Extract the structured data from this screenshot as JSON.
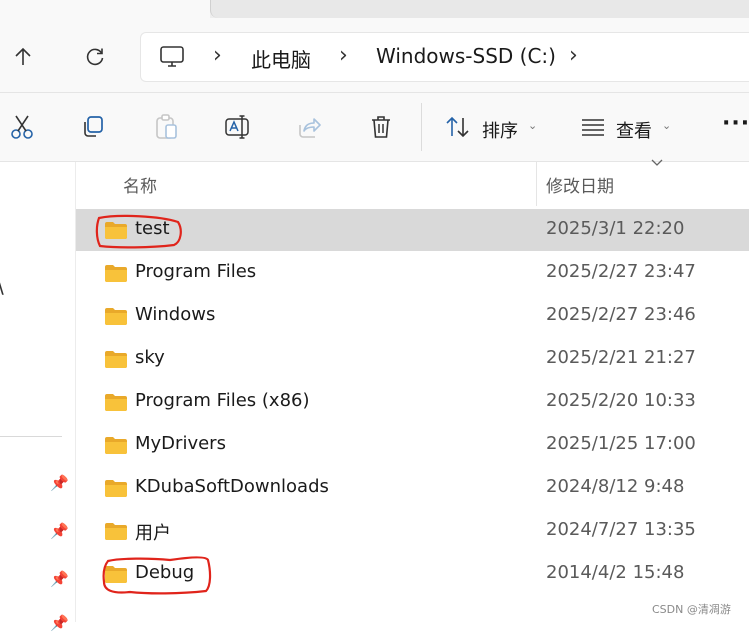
{
  "navigation": {
    "breadcrumb": [
      "此电脑",
      "Windows-SSD (C:)"
    ],
    "icons": [
      "up-arrow-icon",
      "refresh-icon",
      "computer-icon",
      "chevron-right-icon"
    ]
  },
  "commands": {
    "icons": [
      "cut-icon",
      "copy-icon",
      "paste-icon",
      "rename-icon",
      "share-icon",
      "delete-icon",
      "sort-icon",
      "view-icon",
      "more-icon"
    ],
    "sort_label": "排序",
    "view_label": "查看",
    "more_label": "···"
  },
  "columns": {
    "name": "名称",
    "date": "修改日期"
  },
  "files": [
    {
      "name": "test",
      "date": "2025/3/1 22:20",
      "selected": true,
      "circled": true
    },
    {
      "name": "Program Files",
      "date": "2025/2/27 23:47"
    },
    {
      "name": "Windows",
      "date": "2025/2/27 23:46"
    },
    {
      "name": "sky",
      "date": "2025/2/21 21:27"
    },
    {
      "name": "Program Files (x86)",
      "date": "2025/2/20 10:33"
    },
    {
      "name": "MyDrivers",
      "date": "2025/1/25 17:00"
    },
    {
      "name": "KDubaSoftDownloads",
      "date": "2024/8/12 9:48"
    },
    {
      "name": "用户",
      "date": "2024/7/27 13:35"
    },
    {
      "name": "Debug",
      "date": "2014/4/2 15:48",
      "circled": true
    }
  ],
  "colors": {
    "selected_row": "#d9d9d9",
    "folder_yellow": "#f8c23a",
    "annotation_red": "#e0241b"
  },
  "watermark": "CSDN @清凋游"
}
